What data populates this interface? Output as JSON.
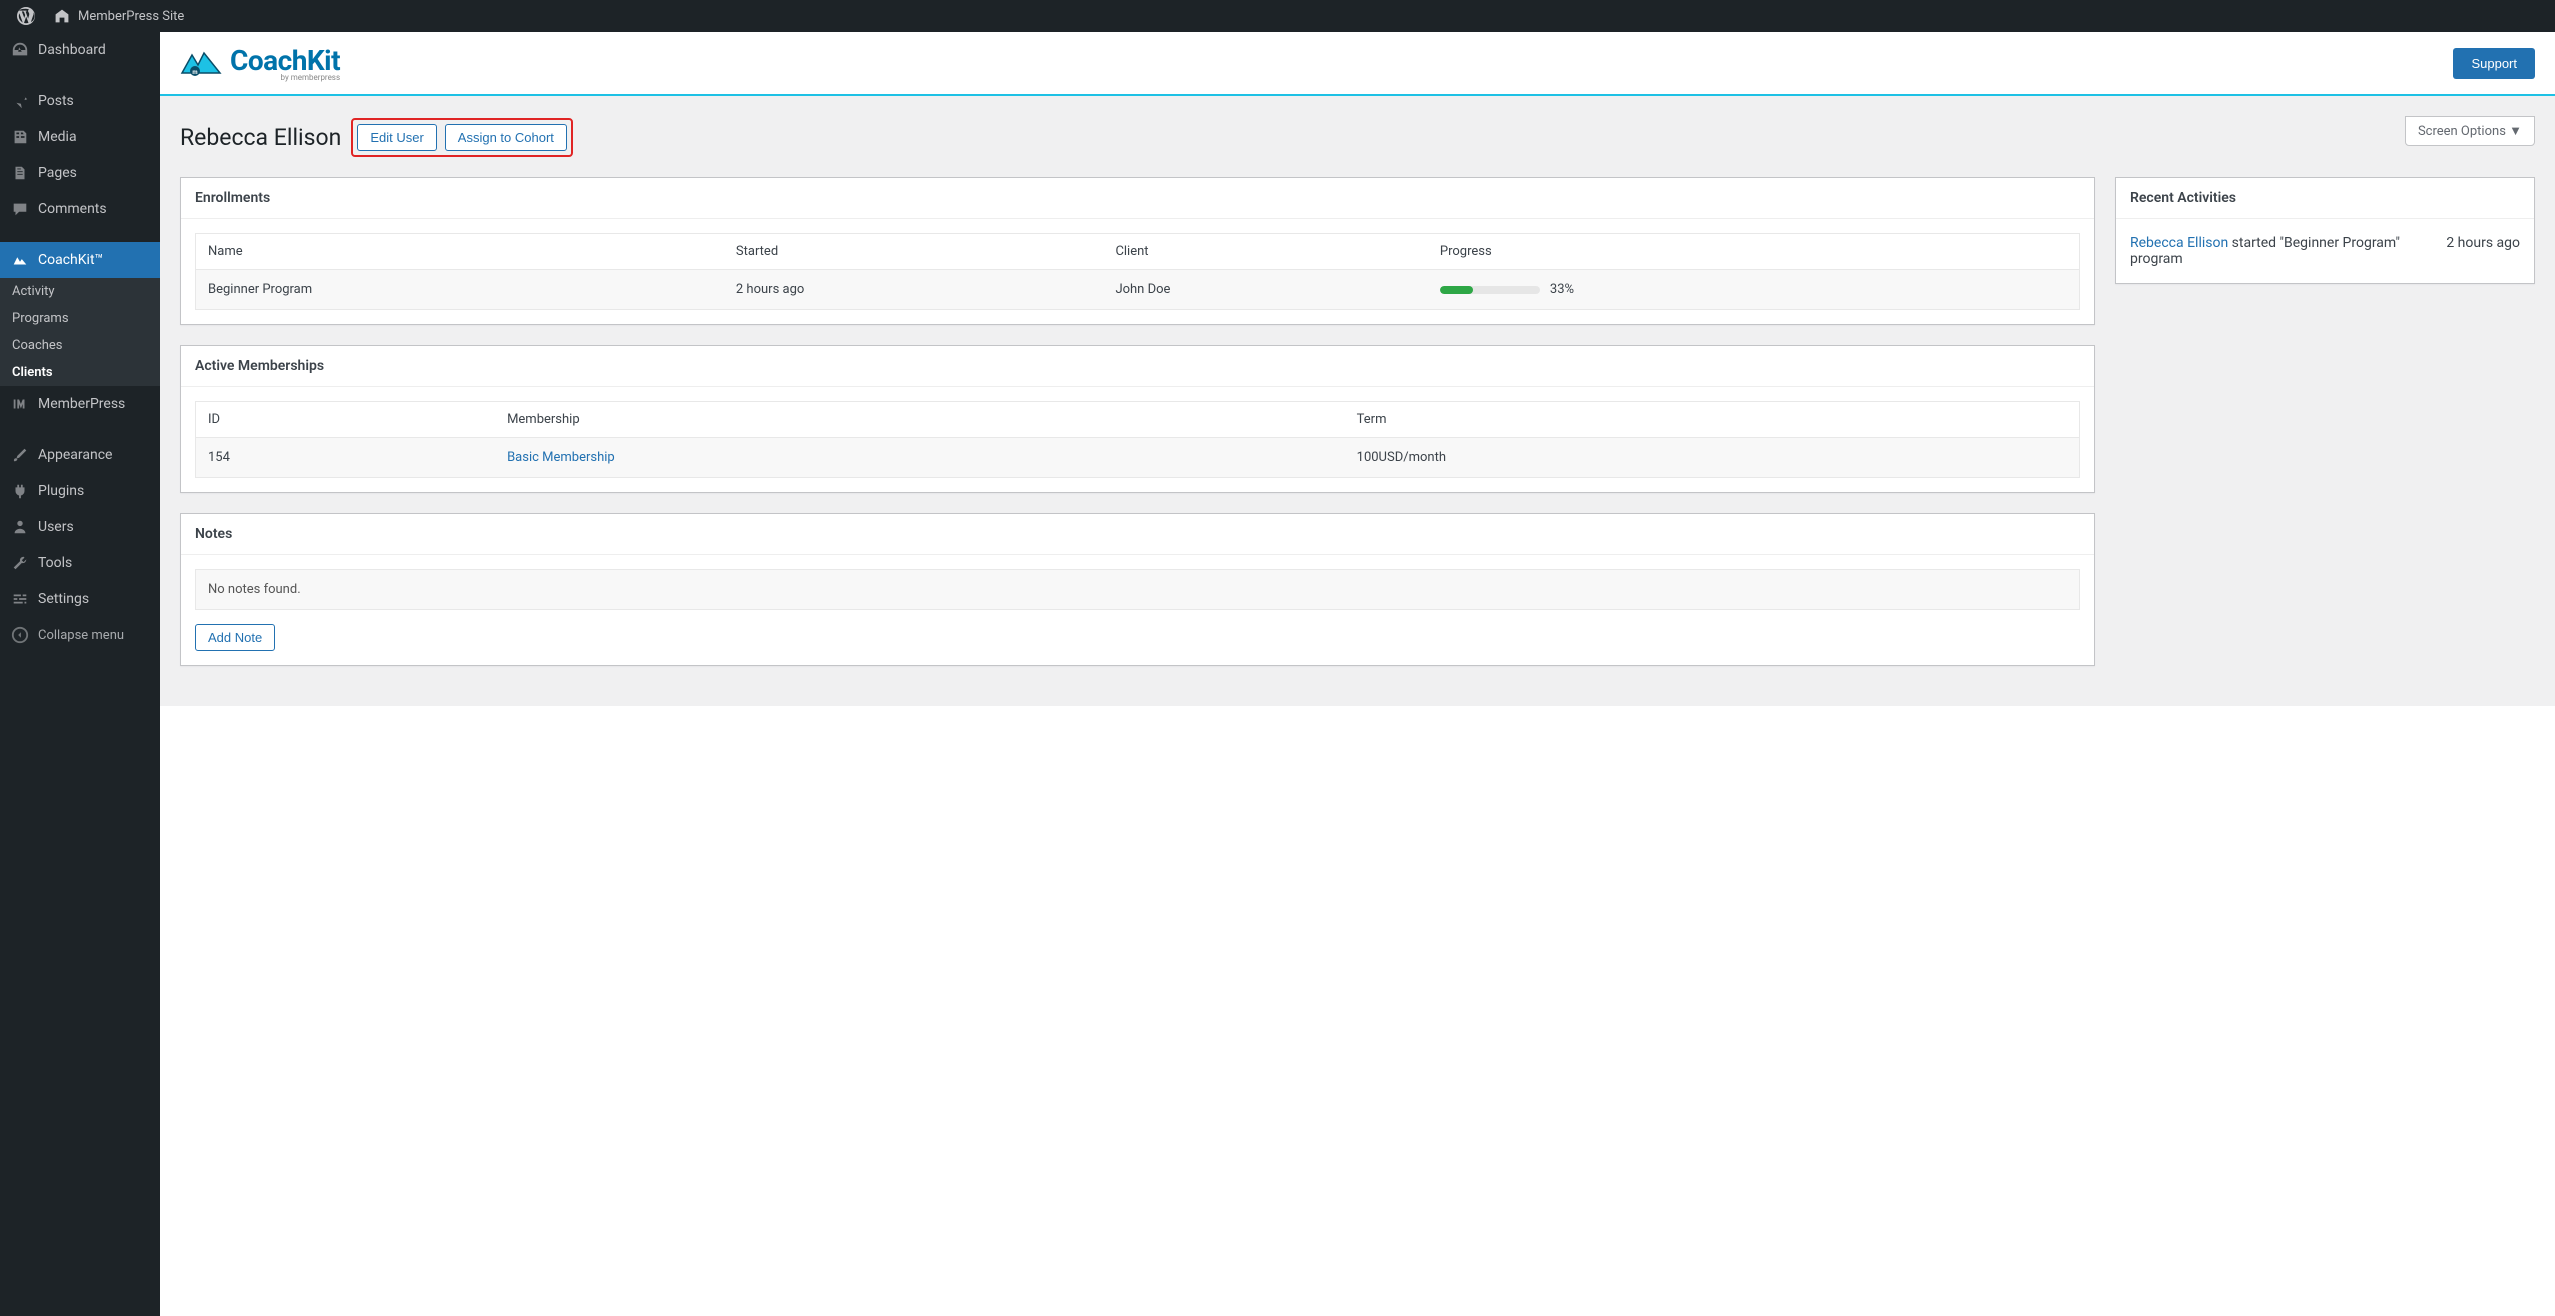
{
  "adminbar": {
    "site_name": "MemberPress Site"
  },
  "sidebar": {
    "items": [
      {
        "label": "Dashboard"
      },
      {
        "label": "Posts"
      },
      {
        "label": "Media"
      },
      {
        "label": "Pages"
      },
      {
        "label": "Comments"
      },
      {
        "label": "CoachKit™"
      },
      {
        "label": "MemberPress"
      },
      {
        "label": "Appearance"
      },
      {
        "label": "Plugins"
      },
      {
        "label": "Users"
      },
      {
        "label": "Tools"
      },
      {
        "label": "Settings"
      }
    ],
    "submenu": [
      {
        "label": "Activity"
      },
      {
        "label": "Programs"
      },
      {
        "label": "Coaches"
      },
      {
        "label": "Clients"
      }
    ],
    "collapse_label": "Collapse menu"
  },
  "header": {
    "logo_text": "CoachKit",
    "logo_sub": "by memberpress",
    "support_label": "Support"
  },
  "screen_options_label": "Screen Options ▼",
  "page": {
    "title": "Rebecca Ellison",
    "edit_user_label": "Edit User",
    "assign_cohort_label": "Assign to Cohort"
  },
  "enrollments": {
    "title": "Enrollments",
    "headers": {
      "name": "Name",
      "started": "Started",
      "client": "Client",
      "progress": "Progress"
    },
    "rows": [
      {
        "name": "Beginner Program",
        "started": "2 hours ago",
        "client": "John Doe",
        "progress_pct": 33,
        "progress_label": "33%"
      }
    ]
  },
  "memberships": {
    "title": "Active Memberships",
    "headers": {
      "id": "ID",
      "membership": "Membership",
      "term": "Term"
    },
    "rows": [
      {
        "id": "154",
        "membership": "Basic Membership",
        "term": "100USD/month"
      }
    ]
  },
  "notes": {
    "title": "Notes",
    "empty_text": "No notes found.",
    "add_label": "Add Note"
  },
  "activities": {
    "title": "Recent Activities",
    "items": [
      {
        "user": "Rebecca Ellison",
        "action": " started \"Beginner Program\" program",
        "time": "2 hours ago"
      }
    ]
  }
}
